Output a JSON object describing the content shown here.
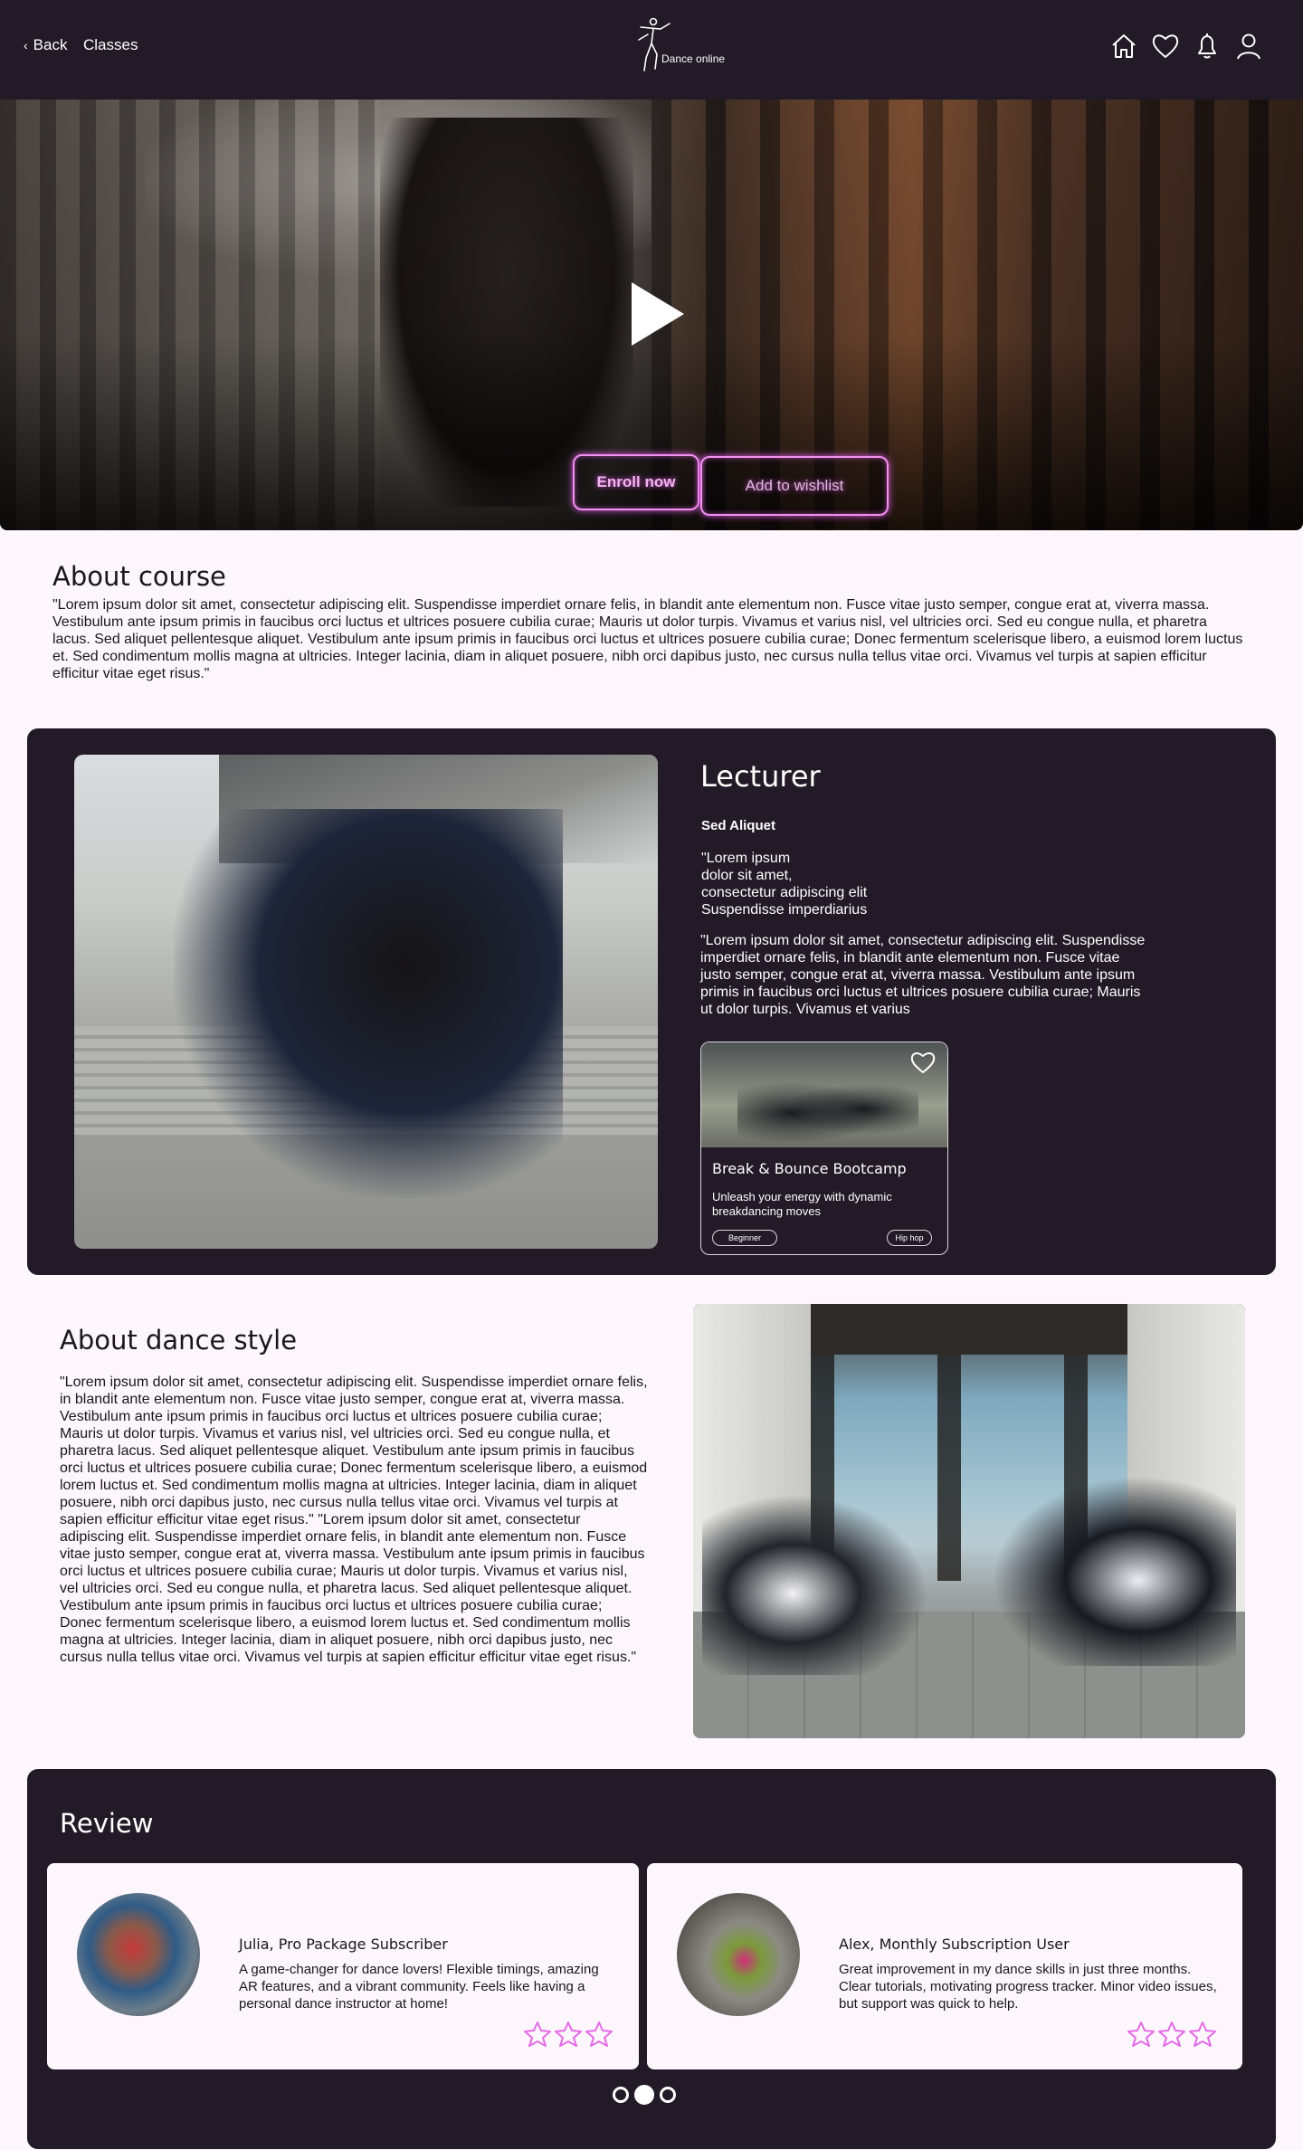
{
  "header": {
    "back_label": "Back",
    "classes_label": "Classes",
    "brand": "Dance online",
    "icons": [
      "home-icon",
      "heart-icon",
      "bell-icon",
      "user-icon"
    ]
  },
  "hero": {
    "enroll_label": "Enroll now",
    "wishlist_label": "Add to wishlist"
  },
  "about_course": {
    "title": "About course",
    "text": "\"Lorem ipsum dolor sit amet, consectetur adipiscing elit. Suspendisse imperdiet ornare felis, in blandit ante elementum non. Fusce vitae justo semper, congue erat at, viverra massa. Vestibulum ante ipsum primis in faucibus orci luctus et ultrices posuere cubilia curae; Mauris ut dolor turpis. Vivamus et varius nisl, vel ultricies orci. Sed eu congue nulla, et pharetra lacus. Sed aliquet pellentesque aliquet. Vestibulum ante ipsum primis in faucibus orci luctus et ultrices posuere cubilia curae; Donec fermentum scelerisque libero, a euismod lorem luctus et. Sed condimentum mollis magna at ultricies. Integer lacinia, diam in aliquet posuere, nibh orci dapibus justo, nec cursus nulla tellus vitae orci. Vivamus vel turpis at sapien efficitur efficitur vitae eget risus.\""
  },
  "lecturer": {
    "title": "Lecturer",
    "name": "Sed Aliquet",
    "quote": "\"Lorem ipsum\ndolor sit amet,\nconsectetur adipiscing elit\nSuspendisse imperdiarius",
    "bio": "\"Lorem ipsum dolor sit amet, consectetur adipiscing elit. Suspendisse imperdiet ornare felis, in blandit ante elementum non. Fusce vitae justo semper, congue erat at, viverra massa. Vestibulum ante ipsum primis in faucibus orci luctus et ultrices posuere cubilia curae; Mauris ut dolor turpis. Vivamus et varius",
    "class_card": {
      "title": "Break & Bounce Bootcamp",
      "description": "Unleash your energy with dynamic breakdancing moves",
      "level": "Beginner",
      "style": "Hip hop"
    }
  },
  "about_style": {
    "title": "About dance style",
    "text": "\"Lorem ipsum dolor sit amet, consectetur adipiscing elit. Suspendisse imperdiet ornare felis, in blandit ante elementum non. Fusce vitae justo semper, congue erat at, viverra massa. Vestibulum ante ipsum primis in faucibus orci luctus et ultrices posuere cubilia curae; Mauris ut dolor turpis. Vivamus et varius nisl, vel ultricies orci. Sed eu congue nulla, et pharetra lacus. Sed aliquet pellentesque aliquet. Vestibulum ante ipsum primis in faucibus orci luctus et ultrices posuere cubilia curae; Donec fermentum scelerisque libero, a euismod lorem luctus et. Sed condimentum mollis magna at ultricies. Integer lacinia, diam in aliquet posuere, nibh orci dapibus justo, nec cursus nulla tellus vitae orci. Vivamus vel turpis at sapien efficitur efficitur vitae eget risus.\" \"Lorem ipsum dolor sit amet, consectetur adipiscing elit. Suspendisse imperdiet ornare felis, in blandit ante elementum non. Fusce vitae justo semper, congue erat at, viverra massa. Vestibulum ante ipsum primis in faucibus orci luctus et ultrices posuere cubilia curae; Mauris ut dolor turpis. Vivamus et varius nisl, vel ultricies orci. Sed eu congue nulla, et pharetra lacus. Sed aliquet pellentesque aliquet. Vestibulum ante ipsum primis in faucibus orci luctus et ultrices posuere cubilia curae; Donec fermentum scelerisque libero, a euismod lorem luctus et. Sed condimentum mollis magna at ultricies. Integer lacinia, diam in aliquet posuere, nibh orci dapibus justo, nec cursus nulla tellus vitae orci. Vivamus vel turpis at sapien efficitur efficitur vitae eget risus.\""
  },
  "review": {
    "title": "Review",
    "items": [
      {
        "name": "Julia, Pro Package Subscriber",
        "text": "A game-changer for dance lovers! Flexible timings, amazing AR features, and a vibrant community. Feels like having a personal dance instructor at home!",
        "rating": 3
      },
      {
        "name": "Alex, Monthly Subscription User",
        "text": "Great improvement in my dance skills in just three months. Clear tutorials, motivating progress tracker. Minor video issues, but support was quick to help.",
        "rating": 3
      }
    ],
    "pager": {
      "count": 3,
      "active": 2
    }
  },
  "colors": {
    "dark": "#221a26",
    "page_bg": "#fdf6fd",
    "neon": "#f091ee",
    "star": "#e46be6"
  }
}
